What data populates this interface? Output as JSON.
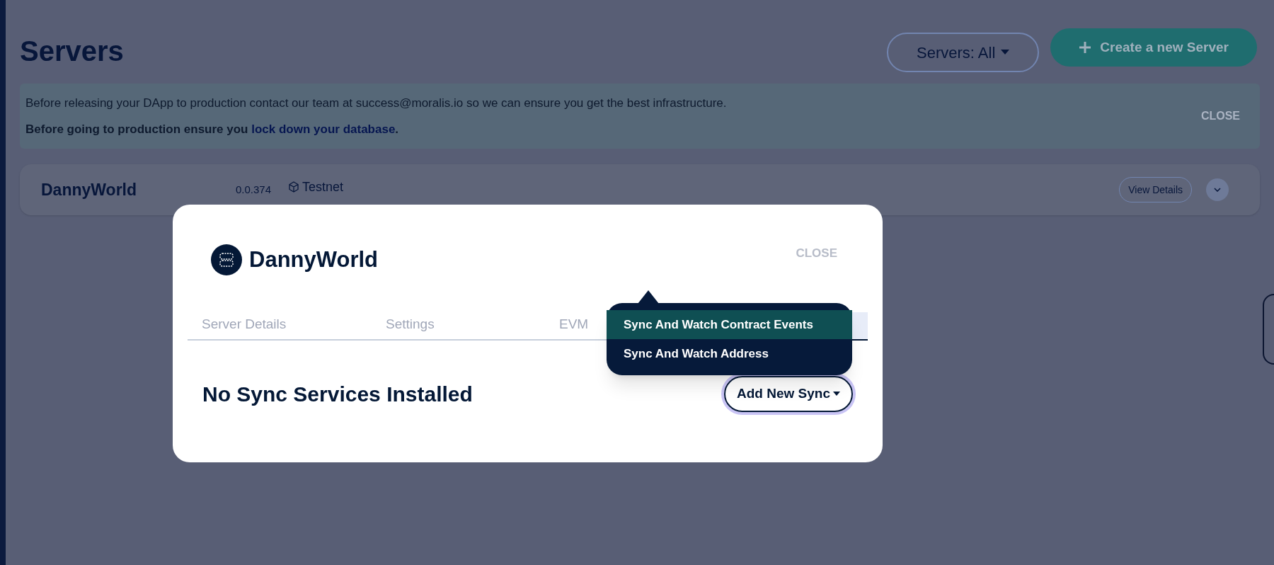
{
  "page": {
    "title": "Servers",
    "filter_button": "Servers: All",
    "create_button": "Create a new Server"
  },
  "banner": {
    "line_1": "Before releasing your DApp to production contact our team at success@moralis.io so we can ensure you get the best infrastructure.",
    "line_2_prefix": "Before going to production ensure you",
    "link": "lock down your database",
    "line_2_suffix": ".",
    "close": "CLOSE"
  },
  "server": {
    "name": "DannyWorld",
    "version": "0.0.374",
    "network": "Testnet",
    "details_button": "View Details"
  },
  "modal": {
    "title": "DannyWorld",
    "close": "CLOSE",
    "tabs": [
      {
        "label": "Server Details",
        "selected": false
      },
      {
        "label": "Settings",
        "selected": false
      },
      {
        "label": "EVM",
        "selected": false
      },
      {
        "selected": true
      }
    ],
    "message": "No Sync Services Installed",
    "add_button": "Add New Sync",
    "menu": [
      {
        "label": "Sync And Watch Contract Events",
        "selected": true
      },
      {
        "label": "Sync And Watch Address",
        "selected": false
      }
    ]
  }
}
